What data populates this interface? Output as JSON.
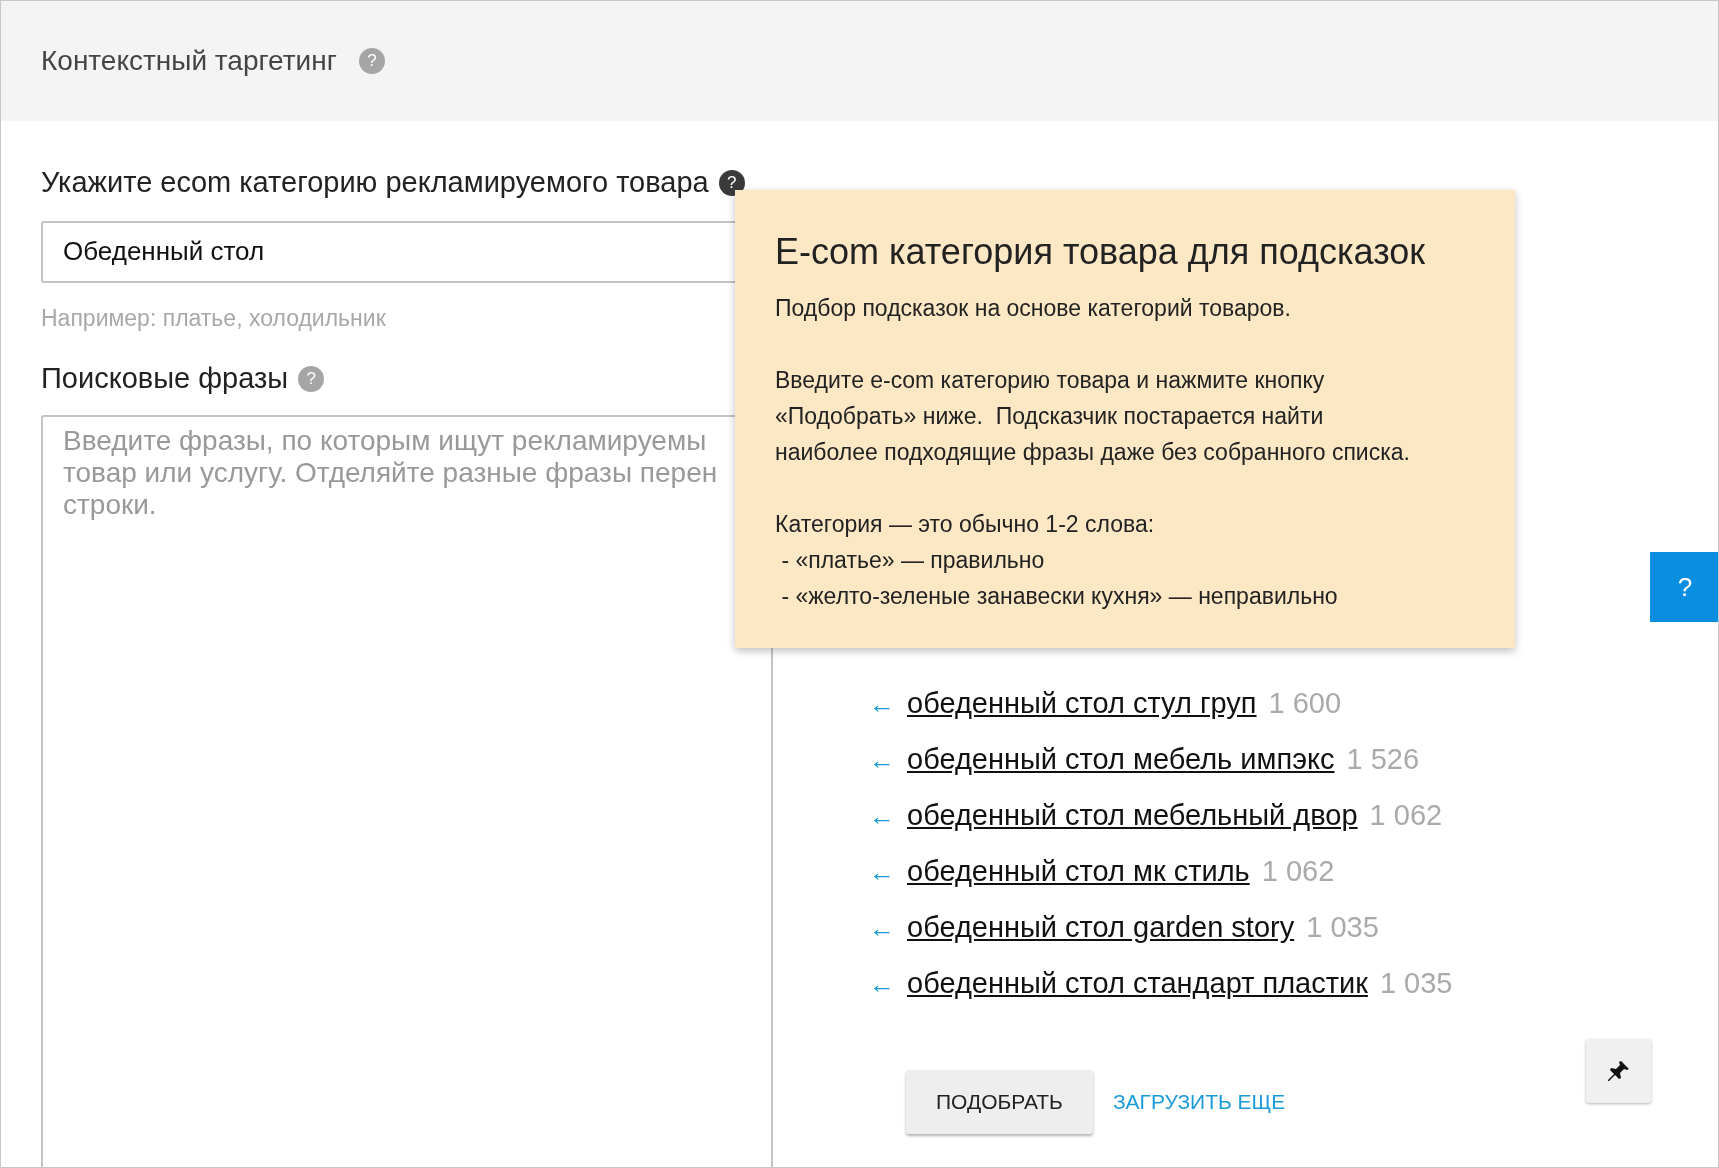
{
  "header": {
    "title": "Контекстный таргетинг",
    "help": "?"
  },
  "category": {
    "label": "Укажите ecom категорию рекламируемого товара",
    "help": "?",
    "value": "Обеденный стол",
    "hint": "Например: платье, холодильник"
  },
  "phrases": {
    "label": "Поисковые фразы",
    "help": "?",
    "placeholder": "Введите фразы, по которым ищут рекламируемы\nтовар или услугу. Отделяйте разные фразы перен\nстроки."
  },
  "suggestions": [
    {
      "arrow": "←",
      "phrase": "обеденный стол стул груп",
      "count": "1 600"
    },
    {
      "arrow": "←",
      "phrase": "обеденный стол мебель импэкс",
      "count": "1 526"
    },
    {
      "arrow": "←",
      "phrase": "обеденный стол мебельный двор",
      "count": "1 062"
    },
    {
      "arrow": "←",
      "phrase": "обеденный стол мк стиль",
      "count": "1 062"
    },
    {
      "arrow": "←",
      "phrase": "обеденный стол garden story",
      "count": "1 035"
    },
    {
      "arrow": "←",
      "phrase": "обеденный стол стандарт пластик",
      "count": "1 035"
    }
  ],
  "buttons": {
    "pick": "ПОДОБРАТЬ",
    "load_more": "ЗАГРУЗИТЬ ЕЩЕ"
  },
  "side_help": "?",
  "tooltip": {
    "title": "E-com категория товара для подсказок",
    "paragraphs": [
      "Подбор подсказок на основе категорий товаров.",
      "Введите e-com категорию товара и нажмите кнопку\n«Подобрать» ниже.  Подсказчик постарается найти\nнаиболее подходящие фразы даже без собранного списка.",
      "Категория — это обычно 1-2 слова:\n - «платье» — правильно\n - «желто-зеленые занавески кухня» — неправильно"
    ]
  }
}
